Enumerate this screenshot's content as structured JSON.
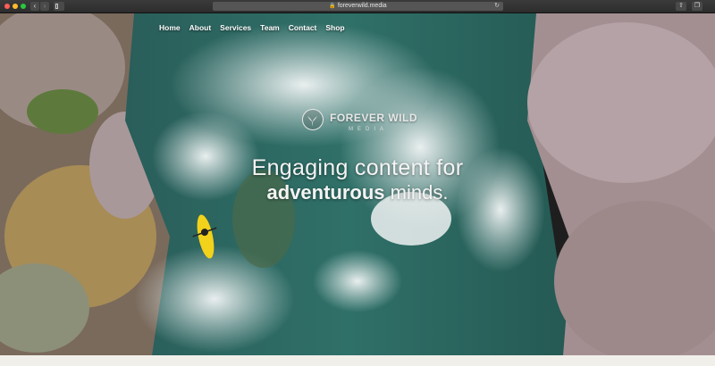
{
  "browser": {
    "url": "foreverwild.media",
    "back_icon": "chevron-left-icon",
    "forward_icon": "chevron-right-icon"
  },
  "nav": {
    "items": [
      {
        "label": "Home"
      },
      {
        "label": "About"
      },
      {
        "label": "Services"
      },
      {
        "label": "Team"
      },
      {
        "label": "Contact"
      },
      {
        "label": "Shop"
      }
    ]
  },
  "logo": {
    "name": "FOREVER WILD",
    "subtitle": "MEDIA"
  },
  "hero": {
    "line1": "Engaging content for",
    "line2_bold": "adventurous",
    "line2_rest": " minds."
  },
  "colors": {
    "water": "#2f6b63",
    "foam": "#e8eef0",
    "forest": "#8a6f66",
    "kayak": "#f2d21a"
  }
}
